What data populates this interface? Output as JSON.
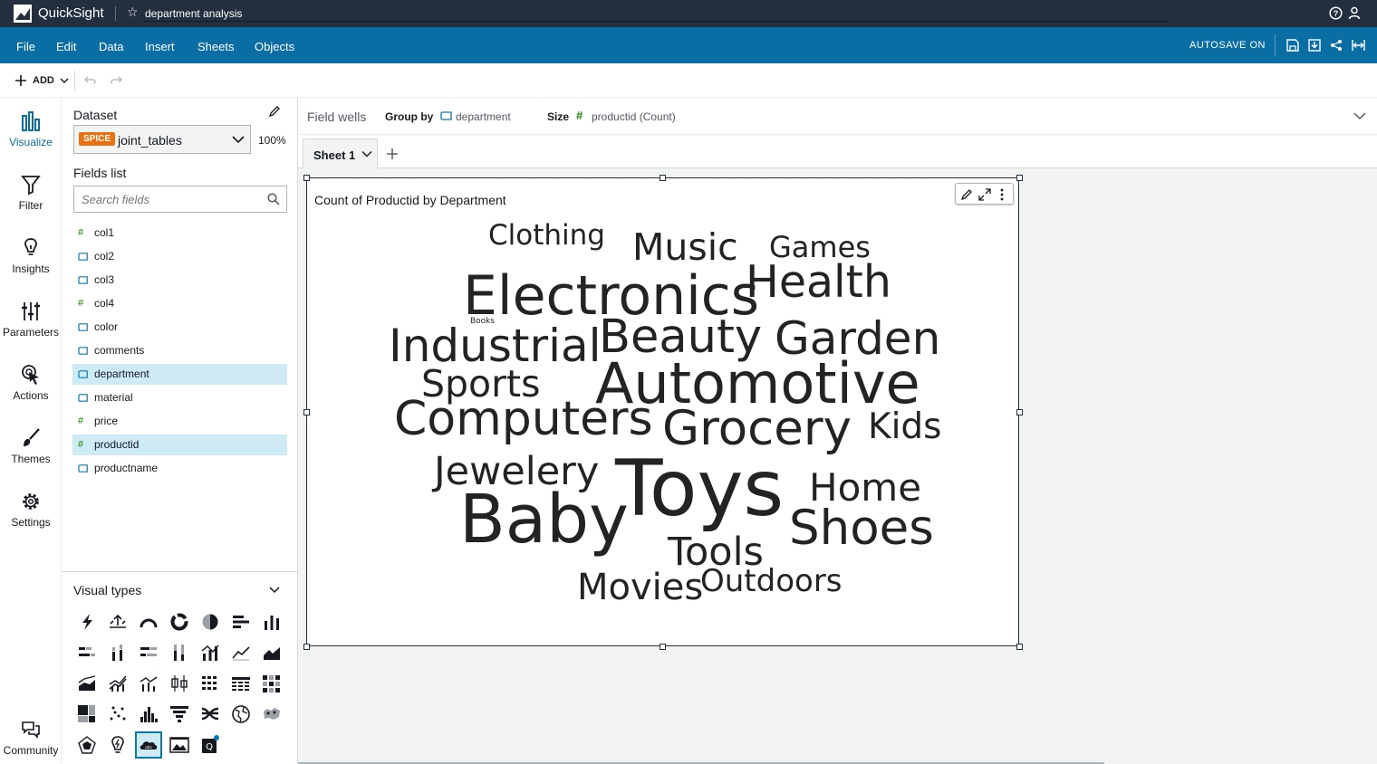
{
  "app": {
    "name": "QuickSight",
    "analysis_title": "department analysis"
  },
  "menu": {
    "items": [
      "File",
      "Edit",
      "Data",
      "Insert",
      "Sheets",
      "Objects"
    ],
    "autosave": "AUTOSAVE ON"
  },
  "toolbar": {
    "add_label": "ADD"
  },
  "leftnav": {
    "items": [
      {
        "label": "Visualize",
        "icon": "bar-chart-icon"
      },
      {
        "label": "Filter",
        "icon": "funnel-icon"
      },
      {
        "label": "Insights",
        "icon": "lightbulb-icon"
      },
      {
        "label": "Parameters",
        "icon": "sliders-icon"
      },
      {
        "label": "Actions",
        "icon": "cursor-click-icon"
      },
      {
        "label": "Themes",
        "icon": "brush-icon"
      },
      {
        "label": "Settings",
        "icon": "gear-icon"
      },
      {
        "label": "Community",
        "icon": "chat-bubbles-icon"
      }
    ]
  },
  "dataset": {
    "heading": "Dataset",
    "badge": "SPICE",
    "name": "joint_tables",
    "percent": "100%"
  },
  "fields": {
    "heading": "Fields list",
    "search_placeholder": "Search fields",
    "items": [
      {
        "name": "col1",
        "type": "measure",
        "selected": false
      },
      {
        "name": "col2",
        "type": "dimension",
        "selected": false
      },
      {
        "name": "col3",
        "type": "dimension",
        "selected": false
      },
      {
        "name": "col4",
        "type": "measure",
        "selected": false
      },
      {
        "name": "color",
        "type": "dimension",
        "selected": false
      },
      {
        "name": "comments",
        "type": "dimension",
        "selected": false
      },
      {
        "name": "department",
        "type": "dimension",
        "selected": true
      },
      {
        "name": "material",
        "type": "dimension",
        "selected": false
      },
      {
        "name": "price",
        "type": "measure",
        "selected": false
      },
      {
        "name": "productid",
        "type": "measure",
        "selected": true
      },
      {
        "name": "productname",
        "type": "dimension",
        "selected": false
      }
    ]
  },
  "visual_types": {
    "heading": "Visual types",
    "selected": "word-cloud"
  },
  "field_wells": {
    "title": "Field wells",
    "group_by_label": "Group by",
    "group_by_value": "department",
    "size_label": "Size",
    "size_value": "productid (Count)"
  },
  "sheet": {
    "tab_label": "Sheet 1"
  },
  "visual": {
    "title": "Count of Productid by Department"
  },
  "chart_data": {
    "type": "word-cloud",
    "title": "Count of Productid by Department",
    "words": [
      {
        "text": "Clothing",
        "weight": 3
      },
      {
        "text": "Music",
        "weight": 4
      },
      {
        "text": "Games",
        "weight": 3
      },
      {
        "text": "Electronics",
        "weight": 6
      },
      {
        "text": "Health",
        "weight": 5
      },
      {
        "text": "Books",
        "weight": 1
      },
      {
        "text": "Industrial",
        "weight": 5
      },
      {
        "text": "Beauty",
        "weight": 5
      },
      {
        "text": "Garden",
        "weight": 5
      },
      {
        "text": "Sports",
        "weight": 4
      },
      {
        "text": "Automotive",
        "weight": 6
      },
      {
        "text": "Computers",
        "weight": 5
      },
      {
        "text": "Grocery",
        "weight": 5
      },
      {
        "text": "Kids",
        "weight": 4
      },
      {
        "text": "Jewelery",
        "weight": 4
      },
      {
        "text": "Toys",
        "weight": 8
      },
      {
        "text": "Home",
        "weight": 4
      },
      {
        "text": "Baby",
        "weight": 7
      },
      {
        "text": "Shoes",
        "weight": 5
      },
      {
        "text": "Tools",
        "weight": 4
      },
      {
        "text": "Movies",
        "weight": 4
      },
      {
        "text": "Outdoors",
        "weight": 3
      }
    ]
  }
}
